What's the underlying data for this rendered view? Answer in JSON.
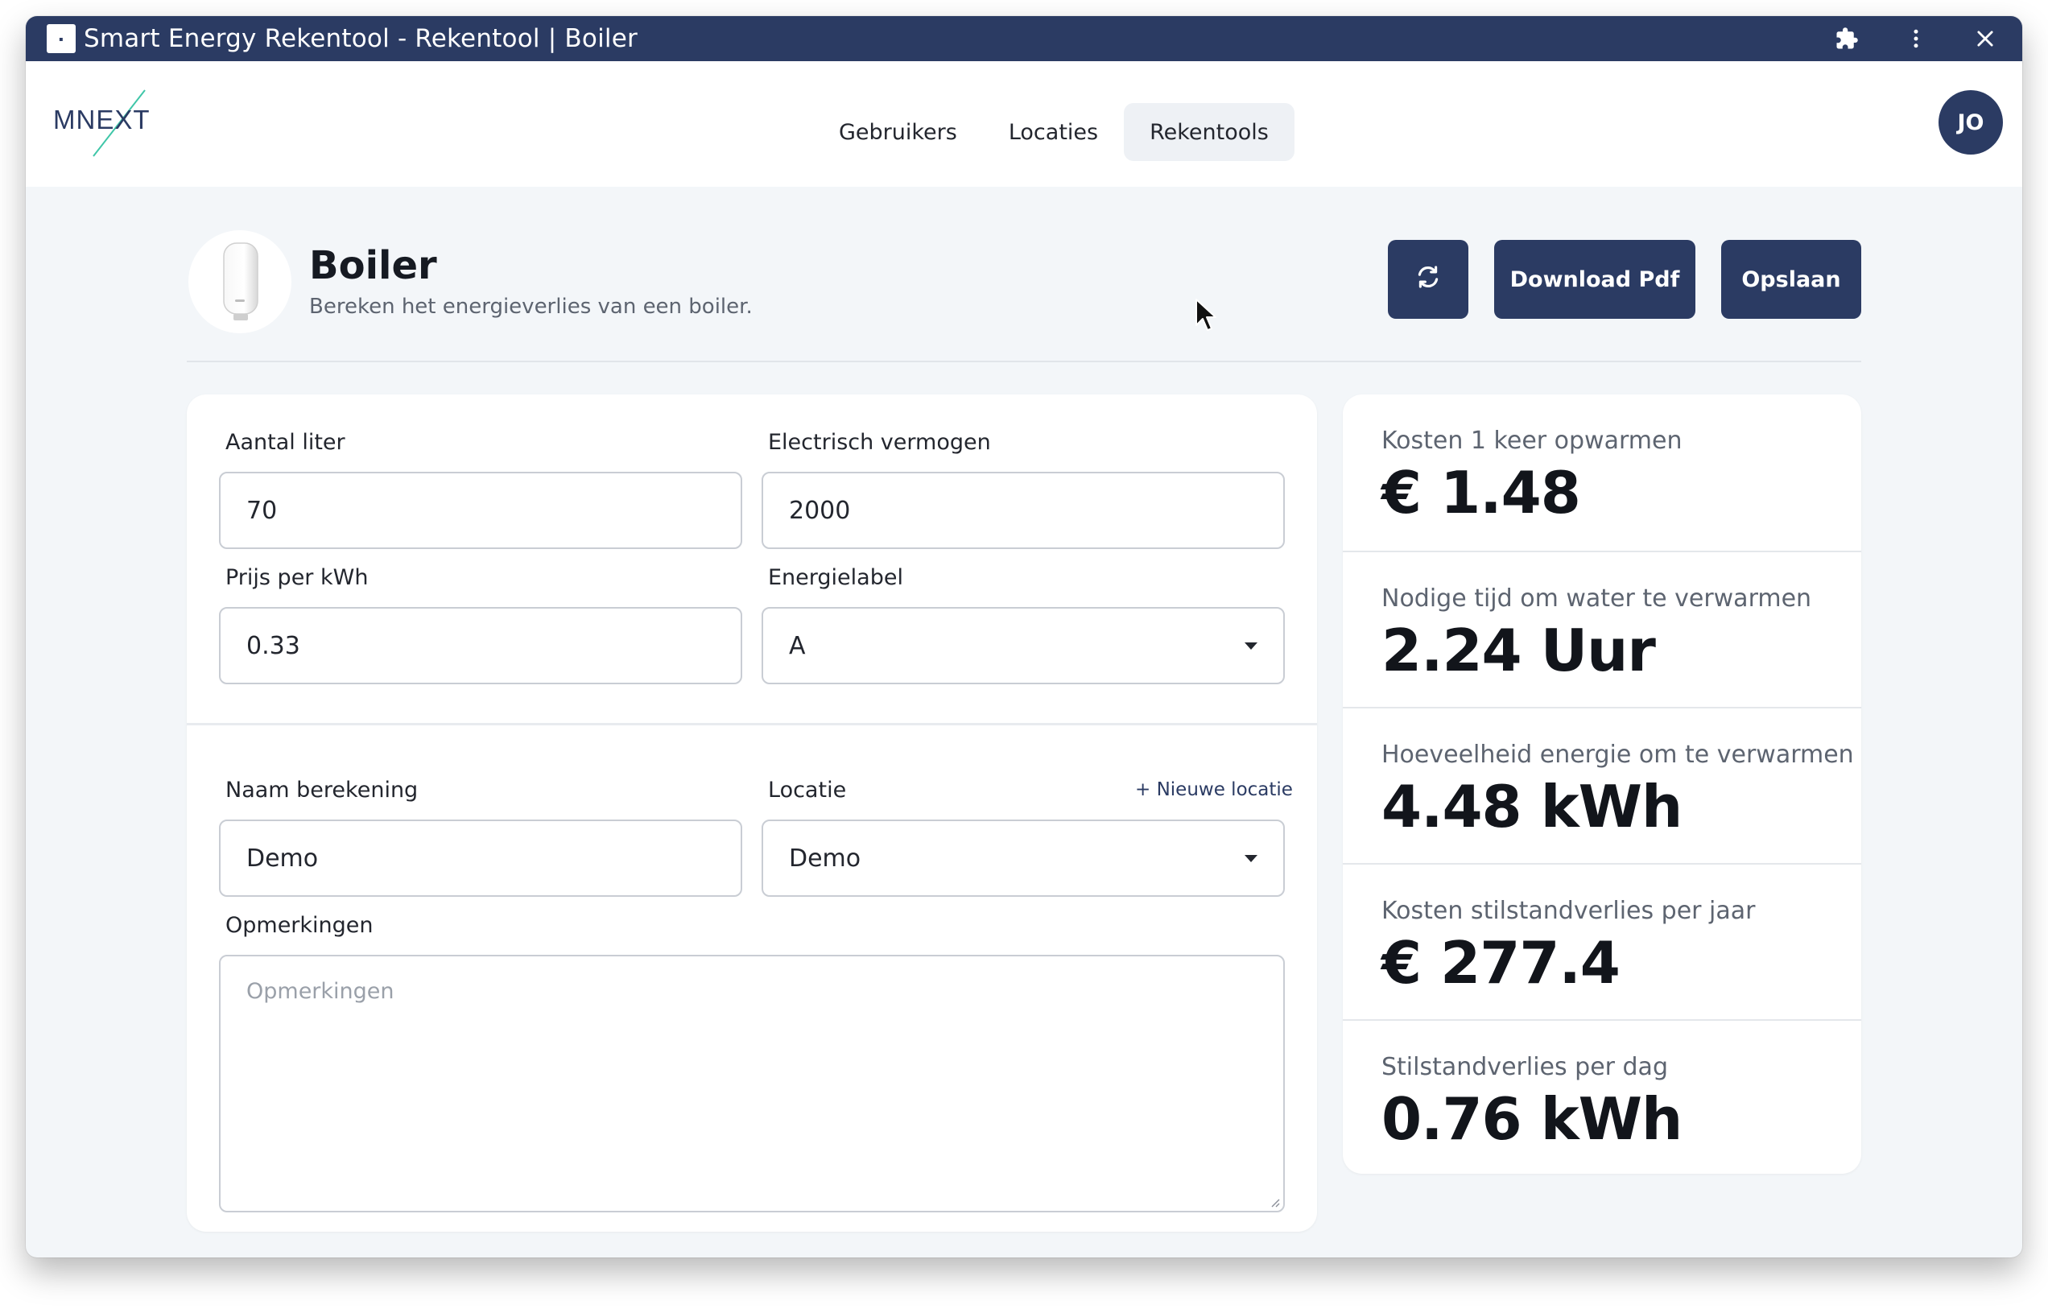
{
  "window": {
    "title": "Smart Energy Rekentool - Rekentool | Boiler"
  },
  "nav": {
    "logo_text": "MNEXT",
    "items": [
      "Gebruikers",
      "Locaties",
      "Rekentools"
    ],
    "active": "Rekentools",
    "avatar_initials": "JO"
  },
  "header": {
    "title": "Boiler",
    "subtitle": "Bereken het energieverlies van een boiler.",
    "download_label": "Download Pdf",
    "save_label": "Opslaan"
  },
  "form": {
    "aantal_liter": {
      "label": "Aantal liter",
      "value": "70"
    },
    "electrisch_vermogen": {
      "label": "Electrisch vermogen",
      "value": "2000"
    },
    "prijs_per_kwh": {
      "label": "Prijs per kWh",
      "value": "0.33"
    },
    "energielabel": {
      "label": "Energielabel",
      "value": "A"
    },
    "naam_berekening": {
      "label": "Naam berekening",
      "value": "Demo"
    },
    "locatie": {
      "label": "Locatie",
      "value": "Demo",
      "new_link": "+ Nieuwe locatie"
    },
    "opmerkingen": {
      "label": "Opmerkingen",
      "placeholder": "Opmerkingen"
    }
  },
  "results": [
    {
      "label": "Kosten 1 keer opwarmen",
      "value": "€ 1.48"
    },
    {
      "label": "Nodige tijd om water te verwarmen",
      "value": "2.24 Uur"
    },
    {
      "label": "Hoeveelheid energie om te verwarmen",
      "value": "4.48 kWh"
    },
    {
      "label": "Kosten stilstandverlies per jaar",
      "value": "€ 277.4"
    },
    {
      "label": "Stilstandverlies per dag",
      "value": "0.76 kWh"
    }
  ],
  "colors": {
    "primary": "#2b3b63",
    "background": "#f3f6f9",
    "logo_accent": "#3fc6a8"
  }
}
